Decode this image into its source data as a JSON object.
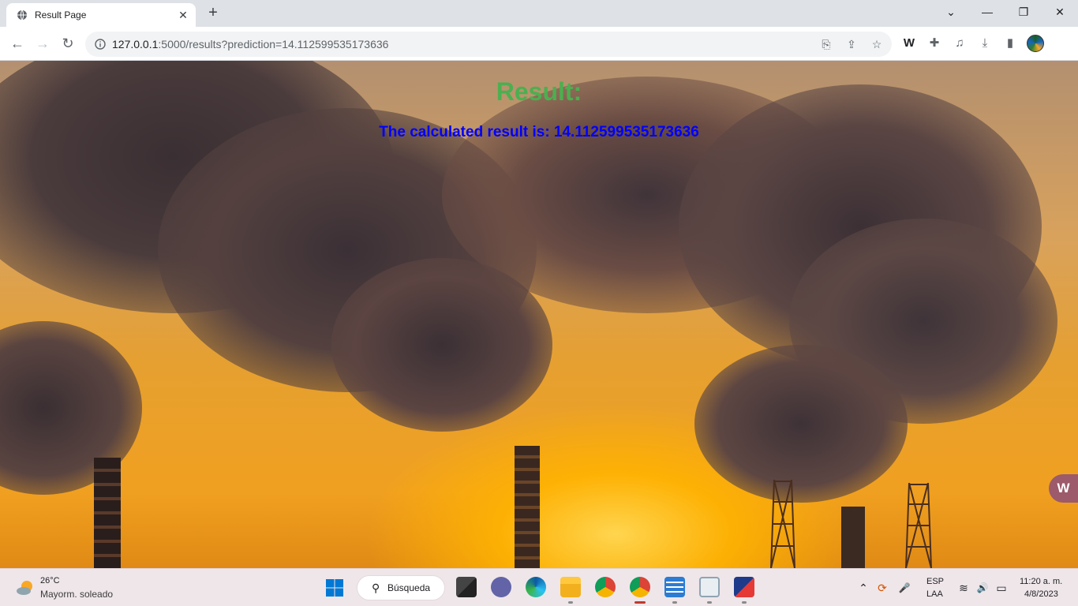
{
  "browser": {
    "tab_title": "Result Page",
    "close_glyph": "✕",
    "new_tab_glyph": "+",
    "url_host": "127.0.0.1",
    "url_rest": ":5000/results?prediction=14.112599535173636",
    "window_controls": {
      "dropdown": "⌄",
      "minimize": "—",
      "restore": "❐",
      "close": "✕"
    }
  },
  "page": {
    "title": "Result:",
    "result_text": "The calculated result is: 14.112599535173636",
    "side_widget": "W",
    "colors": {
      "title": "#4caf50",
      "result": "#0000ff"
    }
  },
  "taskbar": {
    "weather_temp": "26°C",
    "weather_desc": "Mayorm. soleado",
    "search_label": "Búsqueda",
    "lang_line1": "ESP",
    "lang_line2": "LAA",
    "clock_time": "11:20 a. m.",
    "clock_date": "4/8/2023"
  },
  "icons": {
    "back": "←",
    "forward": "→",
    "reload": "↻",
    "translate": "⎘",
    "share": "⇪",
    "star": "☆",
    "w_ext": "W",
    "puzzle": "✚",
    "media": "♫",
    "download": "⤓",
    "sidepanel": "▮",
    "chevron_up": "⌃",
    "mic": "🎤",
    "wifi": "≋",
    "volume": "🔊",
    "battery": "▭"
  }
}
